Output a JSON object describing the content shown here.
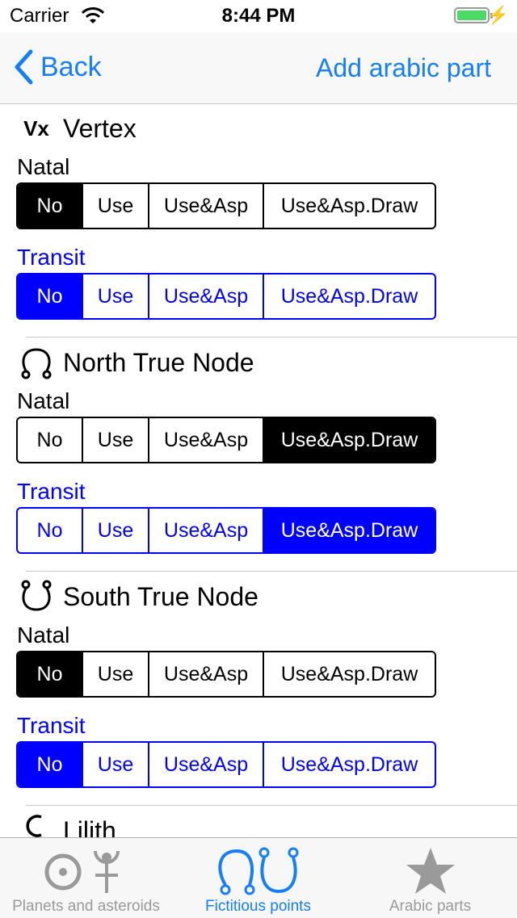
{
  "status": {
    "carrier": "Carrier",
    "time": "8:44 PM"
  },
  "nav": {
    "back": "Back",
    "right_action": "Add arabic part"
  },
  "sections": [
    {
      "title": "Vertex",
      "glyph": "Vx",
      "natal_label": "Natal",
      "transit_label": "Transit",
      "natal_selected": "No",
      "transit_selected": "No"
    },
    {
      "title": "North True Node",
      "glyph": "north-node-icon",
      "natal_label": "Natal",
      "transit_label": "Transit",
      "natal_selected": "Use&Asp.Draw",
      "transit_selected": "Use&Asp.Draw"
    },
    {
      "title": "South True Node",
      "glyph": "south-node-icon",
      "natal_label": "Natal",
      "transit_label": "Transit",
      "natal_selected": "No",
      "transit_selected": "No"
    },
    {
      "title": "Lilith",
      "glyph": "lilith-icon"
    }
  ],
  "options": [
    "No",
    "Use",
    "Use&Asp",
    "Use&Asp.Draw"
  ],
  "tabs": [
    {
      "label": "Planets and asteroids",
      "icon": "planets-icon",
      "active": false
    },
    {
      "label": "Fictitious points",
      "icon": "fictitious-points-icon",
      "active": true
    },
    {
      "label": "Arabic parts",
      "icon": "star-icon",
      "active": false
    }
  ],
  "colors": {
    "accent": "#157efb",
    "transit": "#0000ff",
    "natal_selected": "#000000"
  }
}
